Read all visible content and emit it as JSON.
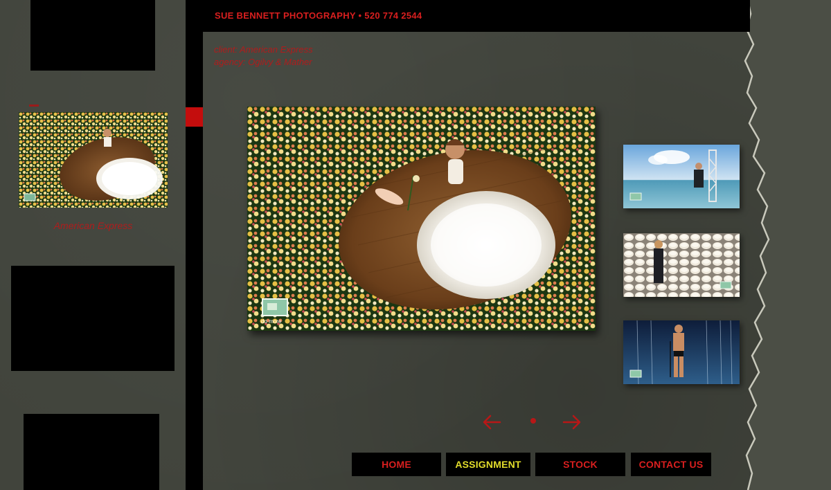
{
  "header": {
    "title": "SUE BENNETT PHOTOGRAPHY • 520 774 2544"
  },
  "credits": {
    "client": "client:  American Express",
    "agency": "agency:  Ogilvy & Mather"
  },
  "left_panel": {
    "thumb_caption": "American Express"
  },
  "main_photo": {
    "card_text": "do more"
  },
  "nav": {
    "home": "HOME",
    "assignment": "ASSIGNMENT",
    "stock": "STOCK",
    "contact": "CONTACT US",
    "active": "assignment"
  },
  "icons": {
    "prev": "left-arrow-icon",
    "next": "right-arrow-icon"
  },
  "colors": {
    "accent_red": "#d91f1f",
    "active_yellow": "#e3dd2b",
    "background": "#41443c"
  }
}
